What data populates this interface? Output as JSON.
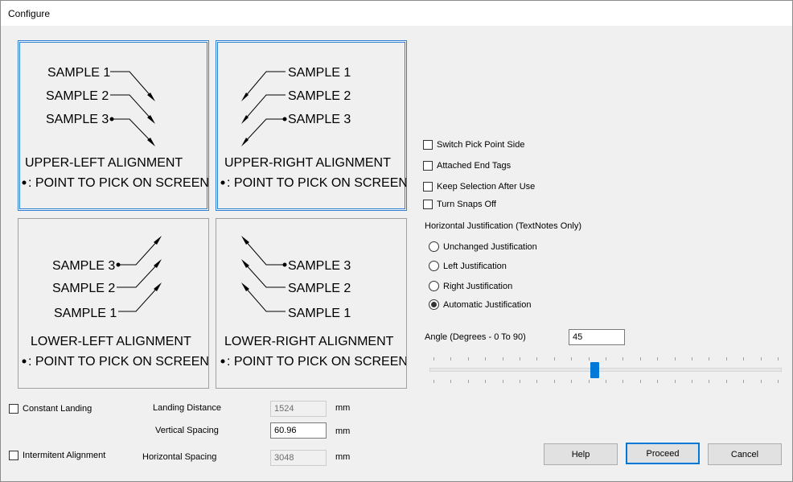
{
  "window": {
    "title": "Configure"
  },
  "panels": [
    {
      "id": "upper-left",
      "lines": [
        "SAMPLE 1",
        "SAMPLE 2",
        "SAMPLE 3"
      ],
      "alignment": "UPPER-LEFT ALIGNMENT",
      "legend": ": POINT TO PICK ON SCREEN",
      "selected": true
    },
    {
      "id": "upper-right",
      "lines": [
        "SAMPLE 1",
        "SAMPLE 2",
        "SAMPLE 3"
      ],
      "alignment": "UPPER-RIGHT ALIGNMENT",
      "legend": ": POINT TO PICK ON SCREEN",
      "selected": true
    },
    {
      "id": "lower-left",
      "lines": [
        "SAMPLE 3",
        "SAMPLE 2",
        "SAMPLE 1"
      ],
      "alignment": "LOWER-LEFT ALIGNMENT",
      "legend": ": POINT TO PICK ON SCREEN",
      "selected": false
    },
    {
      "id": "lower-right",
      "lines": [
        "SAMPLE 3",
        "SAMPLE 2",
        "SAMPLE 1"
      ],
      "alignment": "LOWER-RIGHT ALIGNMENT",
      "legend": ": POINT TO PICK ON SCREEN",
      "selected": false
    }
  ],
  "options": {
    "switch_pick_point": {
      "label": "Switch Pick Point Side",
      "checked": false
    },
    "attached_end_tags": {
      "label": "Attached End Tags",
      "checked": false
    },
    "keep_selection": {
      "label": "Keep Selection After Use",
      "checked": false
    },
    "turn_snaps_off": {
      "label": "Turn Snaps Off",
      "checked": false
    }
  },
  "justification": {
    "heading": "Horizontal Justification (TextNotes Only)",
    "choices": [
      {
        "label": "Unchanged Justification",
        "selected": false
      },
      {
        "label": "Left Justification",
        "selected": false
      },
      {
        "label": "Right Justification",
        "selected": false
      },
      {
        "label": "Automatic Justification",
        "selected": true
      }
    ]
  },
  "angle": {
    "label": "Angle (Degrees - 0 To 90)",
    "value": "45",
    "slider_fraction": 0.5
  },
  "landing": {
    "constant_landing": {
      "label": "Constant Landing",
      "checked": false
    },
    "intermitent_alignment": {
      "label": "Intermitent Alignment",
      "checked": false
    },
    "landing_distance": {
      "label": "Landing Distance",
      "value": "1524",
      "unit": "mm"
    },
    "vertical_spacing": {
      "label": "Vertical Spacing",
      "value": "60.96",
      "unit": "mm"
    },
    "horizontal_spacing": {
      "label": "Horizontal Spacing",
      "value": "3048",
      "unit": "mm"
    }
  },
  "buttons": {
    "help": "Help",
    "proceed": "Proceed",
    "cancel": "Cancel"
  },
  "colors": {
    "accent": "#0078d7",
    "panel_border_selected": "#2d7dd2"
  }
}
